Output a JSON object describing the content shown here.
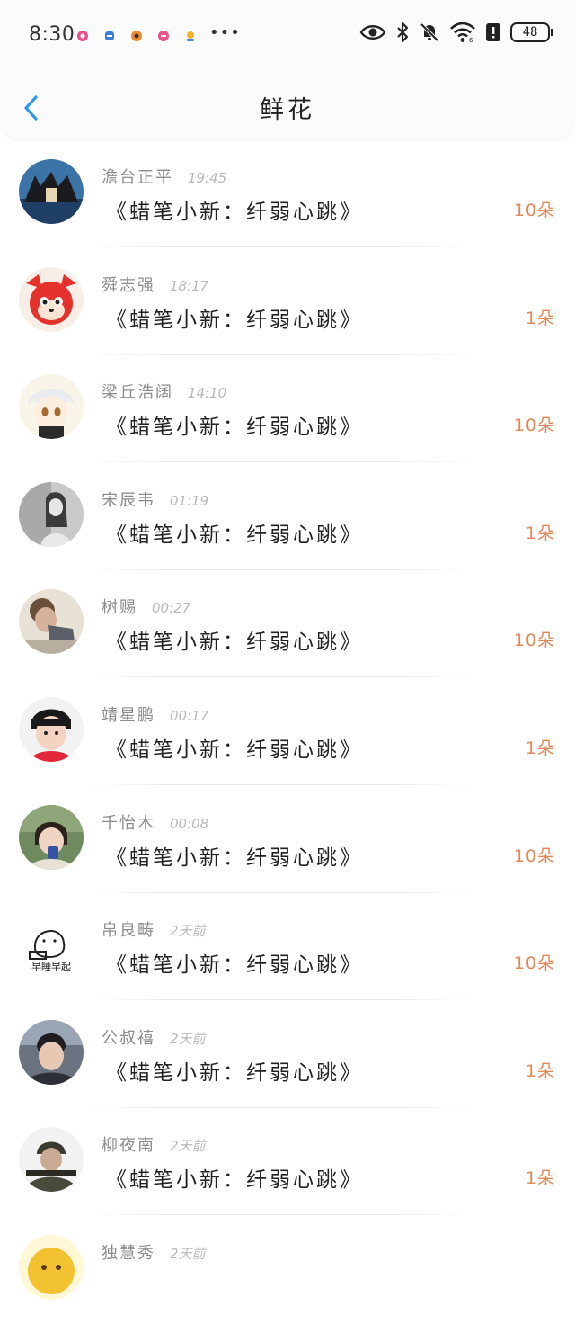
{
  "status_bar": {
    "time": "8:30",
    "more_dots": "•••",
    "battery": "48",
    "notification_icons": [
      "pink-app-icon",
      "blue-app-icon",
      "orange-app-icon",
      "rose-app-icon",
      "yellow-app-icon"
    ],
    "system_icons": [
      "eye-icon",
      "bluetooth-icon",
      "bell-off-icon",
      "wifi-icon",
      "alert-icon",
      "battery-icon"
    ]
  },
  "header": {
    "title": "鲜花",
    "back_icon": "chevron-left-icon"
  },
  "colors": {
    "accent": "#2f9ae8",
    "count": "#e0895a",
    "name": "#8c8c8c",
    "time": "#b9b9b9"
  },
  "items": [
    {
      "name": "澹台正平",
      "time": "19:45",
      "book": "《蜡笔小新：纤弱心跳》",
      "count": "10朵"
    },
    {
      "name": "舜志强",
      "time": "18:17",
      "book": "《蜡笔小新：纤弱心跳》",
      "count": "1朵"
    },
    {
      "name": "梁丘浩阔",
      "time": "14:10",
      "book": "《蜡笔小新：纤弱心跳》",
      "count": "10朵"
    },
    {
      "name": "宋辰韦",
      "time": "01:19",
      "book": "《蜡笔小新：纤弱心跳》",
      "count": "1朵"
    },
    {
      "name": "树赐",
      "time": "00:27",
      "book": "《蜡笔小新：纤弱心跳》",
      "count": "10朵"
    },
    {
      "name": "靖星鹏",
      "time": "00:17",
      "book": "《蜡笔小新：纤弱心跳》",
      "count": "1朵"
    },
    {
      "name": "千怡木",
      "time": "00:08",
      "book": "《蜡笔小新：纤弱心跳》",
      "count": "10朵"
    },
    {
      "name": "帛良畴",
      "time": "2天前",
      "book": "《蜡笔小新：纤弱心跳》",
      "count": "10朵",
      "avatar_text": "早睡早起"
    },
    {
      "name": "公叔禧",
      "time": "2天前",
      "book": "《蜡笔小新：纤弱心跳》",
      "count": "1朵"
    },
    {
      "name": "柳夜南",
      "time": "2天前",
      "book": "《蜡笔小新：纤弱心跳》",
      "count": "1朵"
    },
    {
      "name": "独慧秀",
      "time": "2天前",
      "book": "",
      "count": ""
    }
  ]
}
